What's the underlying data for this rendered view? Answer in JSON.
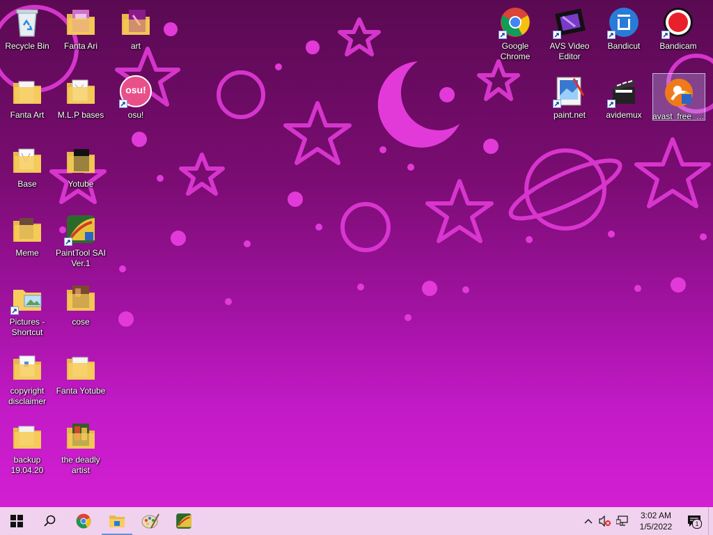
{
  "desktop": {
    "icons": [
      {
        "label": "Recycle Bin",
        "icon": "recycle-bin-icon"
      },
      {
        "label": "Fanta Ari",
        "icon": "folder-icon"
      },
      {
        "label": "art",
        "icon": "folder-icon"
      },
      {
        "label": "Fanta Art",
        "icon": "folder-icon"
      },
      {
        "label": "M.L.P bases",
        "icon": "folder-icon"
      },
      {
        "label": "osu!",
        "icon": "osu-icon",
        "badge": "osu!"
      },
      {
        "label": "Base",
        "icon": "folder-icon"
      },
      {
        "label": "Yotube",
        "icon": "folder-icon"
      },
      {
        "label": "Meme",
        "icon": "folder-icon"
      },
      {
        "label": "PaintTool SAI Ver.1",
        "icon": "painttool-sai-icon"
      },
      {
        "label": "Pictures - Shortcut",
        "icon": "folder-icon"
      },
      {
        "label": "cose",
        "icon": "folder-icon"
      },
      {
        "label": "copyright disclaimer",
        "icon": "folder-icon"
      },
      {
        "label": "Fanta Yotube",
        "icon": "folder-icon"
      },
      {
        "label": "backup 19.04.20",
        "icon": "folder-icon"
      },
      {
        "label": "the deadly artist",
        "icon": "folder-icon"
      },
      {
        "label": "Google Chrome",
        "icon": "chrome-icon"
      },
      {
        "label": "AVS Video Editor",
        "icon": "avs-video-editor-icon"
      },
      {
        "label": "Bandicut",
        "icon": "bandicut-icon"
      },
      {
        "label": "Bandicam",
        "icon": "bandicam-icon"
      },
      {
        "label": "paint.net",
        "icon": "paint-net-icon"
      },
      {
        "label": "avidemux",
        "icon": "avidemux-icon"
      },
      {
        "label": "avast_free_antivirus_setup",
        "icon": "avast-icon"
      }
    ]
  },
  "taskbar": {
    "buttons": [
      {
        "name": "start-button",
        "icon": "windows-logo-icon"
      },
      {
        "name": "search-button",
        "icon": "search-icon"
      },
      {
        "name": "taskbar-chrome",
        "icon": "chrome-icon"
      },
      {
        "name": "taskbar-file-explorer",
        "icon": "file-explorer-icon"
      },
      {
        "name": "taskbar-paint",
        "icon": "paint-palette-icon"
      },
      {
        "name": "taskbar-painttool-sai",
        "icon": "painttool-sai-icon"
      }
    ],
    "tray": {
      "time": "3:02 AM",
      "date": "1/5/2022",
      "notification_count": "1"
    }
  },
  "colors": {
    "wallpaper_top": "#5a0a52",
    "wallpaper_bottom": "#d21fd2",
    "accent_pink": "#e23ad8",
    "taskbar": "#f0d2ee"
  }
}
